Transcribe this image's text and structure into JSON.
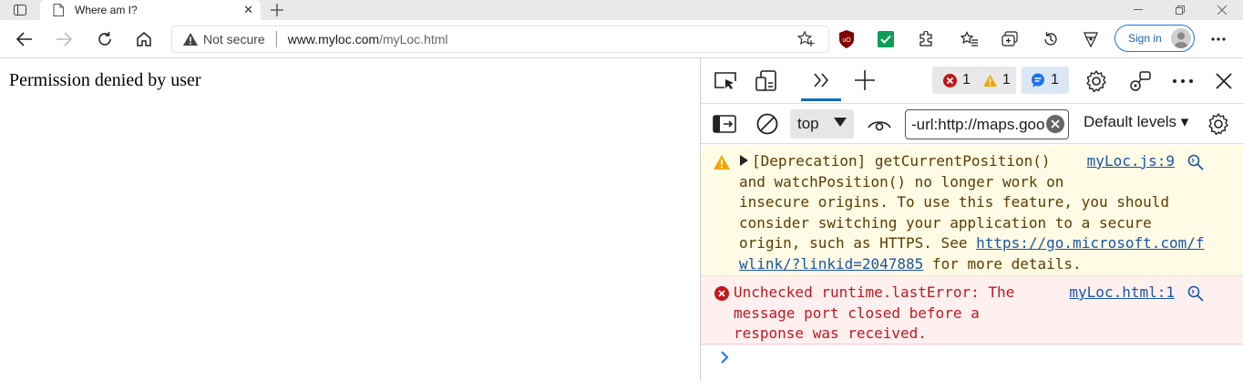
{
  "tab": {
    "title": "Where am I?",
    "close": "✕"
  },
  "address": {
    "security_label": "Not secure",
    "url_host": "www.myloc.com",
    "url_path": "/myLoc.html"
  },
  "signin": {
    "label": "Sign in"
  },
  "page": {
    "message": "Permission denied by user"
  },
  "devtools": {
    "error_count": "1",
    "warning_count": "1",
    "info_count": "1",
    "context": "top",
    "filter_value": "-url:http://maps.goo",
    "levels": "Default levels ▾",
    "messages": [
      {
        "level": "warning",
        "line1": "[Deprecation] getCurrentPosition()",
        "line2": "and watchPosition() no longer work on",
        "line3": "insecure origins. To use this feature, you should",
        "line4": "consider switching your application to a secure",
        "line5_pre": "origin, such as HTTPS. See ",
        "link_part1": "https://go.microsoft.com/f",
        "link_part2": "wlink/?linkid=2047885",
        "line6_post": " for more details.",
        "source": "myLoc.js:9"
      },
      {
        "level": "error",
        "line1": "Unchecked runtime.lastError: The",
        "line2": "message port closed before a",
        "line3": "response was received.",
        "source": "myLoc.html:1"
      }
    ]
  },
  "colors": {
    "accent": "#0f6cbd",
    "error": "#c4161c",
    "warning": "#f2a600",
    "success": "#0f9d58"
  }
}
